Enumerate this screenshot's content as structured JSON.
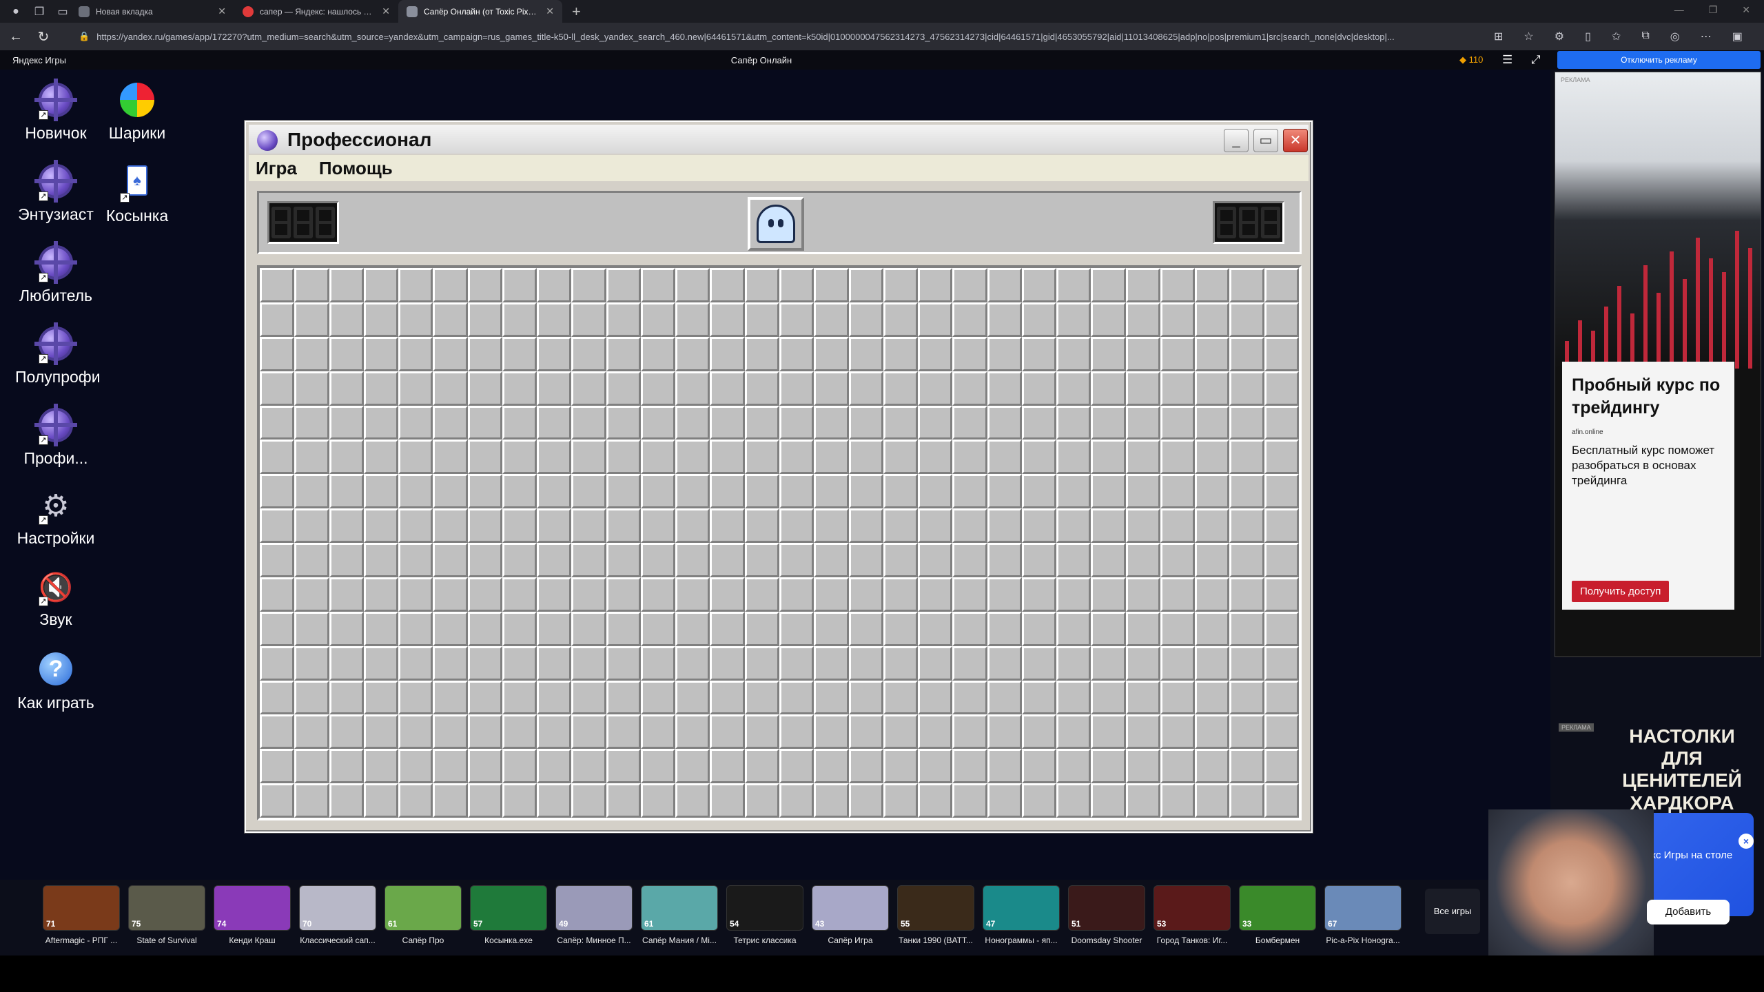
{
  "browser": {
    "tabs": [
      {
        "label": "Новая вкладка",
        "color": "#6b6f7a"
      },
      {
        "label": "сапер — Яндекс: нашлось 44 т...",
        "color": "#e03a3a"
      },
      {
        "label": "Сапёр Онлайн (от Toxic Pixels)...",
        "color": "#8a8f9c"
      }
    ],
    "new_tab": "+",
    "url": "https://yandex.ru/games/app/172270?utm_medium=search&utm_source=yandex&utm_campaign=rus_games_title-k50-ll_desk_yandex_search_460.new|64461571&utm_content=k50id|0100000047562314273_47562314273|cid|64461571|gid|4653055792|aid|11013408625|adp|no|pos|premium1|src|search_none|dvc|desktop|..."
  },
  "topbar": {
    "site": "Яндекс Игры",
    "game_title": "Сапёр Онлайн",
    "coins": "110",
    "disable_ads": "Отключить рекламу"
  },
  "desktop": {
    "icons": [
      {
        "label": "Новичок",
        "icon": "mine-icon"
      },
      {
        "label": "Шарики",
        "icon": "balls-icon"
      },
      {
        "label": "Энтузиаст",
        "icon": "mine-icon"
      },
      {
        "label": "Косынка",
        "icon": "cards-icon"
      },
      {
        "label": "Любитель",
        "icon": "mine-icon"
      },
      {
        "label": "Полупрофи",
        "icon": "mine-icon"
      },
      {
        "label": "Профи...",
        "icon": "mine-icon"
      },
      {
        "label": "Настройки",
        "icon": "settings-icon"
      },
      {
        "label": "Звук",
        "icon": "sound-icon"
      },
      {
        "label": "Как играть",
        "icon": "help-icon"
      }
    ]
  },
  "window": {
    "title": "Профессионал",
    "menu": [
      "Игра",
      "Помощь"
    ],
    "mines_counter": "",
    "timer": "",
    "grid": {
      "cols": 30,
      "rows": 16
    }
  },
  "ad_right": {
    "label": "РЕКЛАМА",
    "headline": "Пробный курс по трейдингу",
    "source": "afin.online",
    "body": "Бесплатный курс поможет разобраться в основах трейдинга",
    "cta": "Получить доступ"
  },
  "ad_bottom": {
    "label": "РЕКЛАМА",
    "headline": "Настолки для ценителей хардкора"
  },
  "promo": {
    "text": "Яндекс Игры на столе",
    "button": "Добавить",
    "close": "×"
  },
  "games": [
    {
      "name": "Aftermagic - РПГ ...",
      "score": "71",
      "color": "#7a3a1a"
    },
    {
      "name": "State of Survival",
      "score": "75",
      "color": "#5a5a4a"
    },
    {
      "name": "Кенди Краш",
      "score": "74",
      "color": "#8a3ab8"
    },
    {
      "name": "Классический сап...",
      "score": "70",
      "color": "#b8b8c8"
    },
    {
      "name": "Сапёр Про",
      "score": "61",
      "color": "#6aa84a"
    },
    {
      "name": "Косынка.exe",
      "score": "57",
      "color": "#1f7a3a"
    },
    {
      "name": "Сапёр: Минное П...",
      "score": "49",
      "color": "#9a9ab8"
    },
    {
      "name": "Сапёр Мания / Mi...",
      "score": "61",
      "color": "#5aa8a8"
    },
    {
      "name": "Тетрис классика",
      "score": "54",
      "color": "#1a1a1a"
    },
    {
      "name": "Сапёр Игра",
      "score": "43",
      "color": "#a8a8c8"
    },
    {
      "name": "Танки 1990 (BATT...",
      "score": "55",
      "color": "#3a2a1a"
    },
    {
      "name": "Нонограммы - яп...",
      "score": "47",
      "color": "#1a8a8a"
    },
    {
      "name": "Doomsday Shooter",
      "score": "51",
      "color": "#3a1a1a"
    },
    {
      "name": "Город Танков: Иг...",
      "score": "53",
      "color": "#5a1a1a"
    },
    {
      "name": "Бомбермен",
      "score": "33",
      "color": "#3a8a2a"
    },
    {
      "name": "Pic-a-Pix Нонogra...",
      "score": "67",
      "color": "#6a8ab8"
    }
  ],
  "all_games": "Все игры"
}
